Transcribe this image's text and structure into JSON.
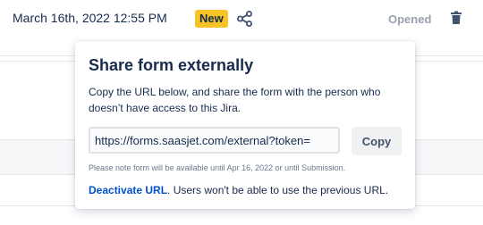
{
  "row": {
    "date": "March 16th, 2022 12:55 PM",
    "badge": "New",
    "status": "Opened",
    "share_icon": "share-icon",
    "delete_icon": "trash-icon"
  },
  "popover": {
    "title": "Share form externally",
    "description": "Copy the URL below, and share the form with the person who doesn’t have access to this Jira.",
    "url_value": "https://forms.saasjet.com/external?token=",
    "copy_label": "Copy",
    "note": "Please note form will be available until Apr 16, 2022 or until Submission.",
    "deactivate_link": "Deactivate URL",
    "deactivate_text": ". Users won't be able to use the previous URL."
  },
  "colors": {
    "badge": "#f7c325",
    "link": "#0052cc",
    "text": "#172b4d",
    "muted": "#97a0af"
  }
}
